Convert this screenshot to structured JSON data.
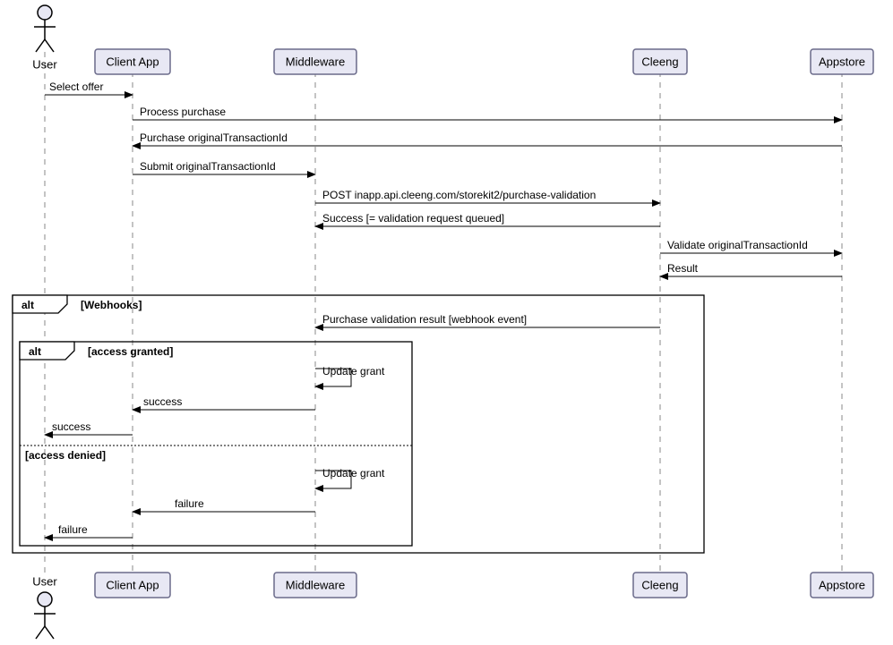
{
  "participants": {
    "user": "User",
    "client": "Client App",
    "middleware": "Middleware",
    "cleeng": "Cleeng",
    "appstore": "Appstore"
  },
  "messages": {
    "m1": "Select offer",
    "m2": "Process purchase",
    "m3": "Purchase originalTransactionId",
    "m4": "Submit originalTransactionId",
    "m5": "POST inapp.api.cleeng.com/storekit2/purchase-validation",
    "m6": "Success [= validation request queued]",
    "m7": "Validate originalTransactionId",
    "m8": "Result",
    "m9": "Purchase validation result [webhook event]",
    "m10": "Update grant",
    "m11": "success",
    "m12": "success",
    "m13": "Update grant",
    "m14": "failure",
    "m15": "failure"
  },
  "frames": {
    "outer_tag": "alt",
    "outer_guard": "[Webhooks]",
    "inner_tag": "alt",
    "inner_guard1": "[access granted]",
    "inner_guard2": "[access denied]"
  }
}
